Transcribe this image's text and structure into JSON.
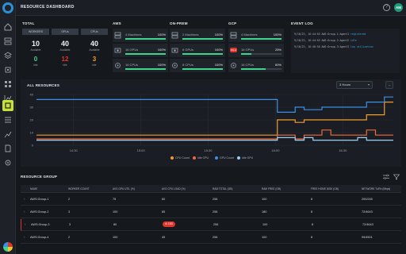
{
  "header": {
    "title": "RESOURCE DASHBOARD",
    "avatar_initials": "AM",
    "help_glyph": "?"
  },
  "sidebar": {
    "items": [
      {
        "icon": "home-icon"
      },
      {
        "icon": "server-icon"
      },
      {
        "icon": "layers-icon"
      },
      {
        "icon": "chip-icon"
      },
      {
        "icon": "grid-icon"
      },
      {
        "icon": "chart-icon"
      },
      {
        "icon": "group-icon",
        "active": true
      },
      {
        "icon": "list-icon"
      },
      {
        "icon": "chart-up-icon"
      },
      {
        "icon": "document-icon"
      },
      {
        "icon": "settings-icon"
      }
    ]
  },
  "total": {
    "label": "TOTAL",
    "columns": [
      {
        "header": "WORKERS",
        "big": "10",
        "sub": "Available",
        "value": "0",
        "value_color": "#3dd68c",
        "value_sub": "Idle"
      },
      {
        "header": "GPUs",
        "big": "40",
        "sub": "Available",
        "value": "12",
        "value_color": "#e0352b",
        "value_sub": "Idle"
      },
      {
        "header": "CPUs",
        "big": "40",
        "sub": "Available",
        "value": "3",
        "value_color": "#f39a2e",
        "value_sub": "Idle"
      }
    ]
  },
  "clouds": [
    {
      "label": "AWS",
      "rows": [
        {
          "icon": "server-icon",
          "text": "4 Machines",
          "pct": "100%",
          "fill": 1.0
        },
        {
          "icon": "gpu-icon",
          "text": "16 GPUs",
          "pct": "100%",
          "fill": 1.0
        },
        {
          "icon": "cpu-icon",
          "text": "16 CPUs",
          "pct": "100%",
          "fill": 1.0
        }
      ]
    },
    {
      "label": "ON-PREM",
      "rows": [
        {
          "icon": "server-icon",
          "text": "2 Machines",
          "pct": "100%",
          "fill": 1.0
        },
        {
          "icon": "gpu-icon",
          "text": "8 GPUs",
          "pct": "100%",
          "fill": 1.0
        },
        {
          "icon": "cpu-icon",
          "text": "8 CPUs",
          "pct": "100%",
          "fill": 1.0
        }
      ]
    },
    {
      "label": "GCP",
      "rows": [
        {
          "icon": "server-icon",
          "text": "4 Machines",
          "pct": "100%",
          "fill": 1.0,
          "badge": false
        },
        {
          "icon": "gpu-icon",
          "text": "16 GPUs",
          "pct": "25%",
          "fill": 0.25,
          "badge": true,
          "badge_text": "IDLE"
        },
        {
          "icon": "cpu-icon",
          "text": "16 CPUs",
          "pct": "60%",
          "fill": 0.6
        }
      ]
    }
  ],
  "event_log": {
    "label": "EVENT LOG",
    "events": [
      {
        "prefix": "9/18/23, 16:44:03  AWS:Group-1:Agent1  ",
        "highlight": "registered"
      },
      {
        "prefix": "9/18/23, 16:44:03  AWS:Group-2:Agent2  ",
        "highlight": "idle"
      },
      {
        "prefix": "9/18/23, 16:46:50  AWS:Group-3:Agent3  ",
        "highlight": "low utilization"
      }
    ]
  },
  "chart_header": {
    "label": "ALL RESOURCES",
    "range": "3 Hours",
    "expand_glyph": "⌄"
  },
  "chart_data": {
    "type": "line",
    "ylim": [
      0,
      40
    ],
    "yticks": [
      "0",
      "10",
      "20",
      "30",
      "40"
    ],
    "xticks": [
      "14:30",
      "15:00",
      "15:30",
      "16:00",
      "16:30"
    ],
    "x": [
      0,
      1,
      2,
      3,
      4,
      5,
      6,
      7,
      8,
      9,
      10,
      11,
      12,
      13,
      14,
      15,
      16,
      17,
      18,
      19,
      20,
      21,
      22,
      23,
      24,
      25,
      26,
      27,
      28,
      29,
      30,
      31,
      32,
      33,
      34,
      35,
      36,
      37,
      38,
      39,
      40
    ],
    "series": [
      {
        "name": "CPU Count",
        "color": "#f39a2e",
        "values": [
          8,
          8,
          8,
          8,
          8,
          8,
          8,
          8,
          8,
          8,
          8,
          8,
          8,
          8,
          8,
          8,
          8,
          8,
          8,
          8,
          8,
          8,
          8,
          8,
          8,
          8,
          8,
          20,
          20,
          18,
          20,
          20,
          20,
          20,
          20,
          20,
          20,
          24,
          24,
          34,
          34
        ]
      },
      {
        "name": "Idle CPU",
        "color": "#ef6a3a",
        "values": [
          5,
          5,
          5,
          5,
          5,
          5,
          5,
          5,
          5,
          5,
          5,
          5,
          5,
          5,
          5,
          5,
          5,
          5,
          5,
          5,
          5,
          5,
          5,
          5,
          5,
          5,
          5,
          8,
          8,
          5,
          8,
          8,
          12,
          8,
          8,
          8,
          8,
          12,
          8,
          8,
          8
        ]
      },
      {
        "name": "GPU Count",
        "color": "#3a8fe6",
        "values": [
          36,
          36,
          36,
          36,
          36,
          36,
          36,
          36,
          36,
          36,
          36,
          36,
          36,
          36,
          36,
          36,
          36,
          36,
          36,
          36,
          36,
          36,
          36,
          36,
          36,
          36,
          36,
          26,
          26,
          30,
          28,
          28,
          30,
          30,
          30,
          30,
          30,
          34,
          34,
          38,
          38
        ]
      },
      {
        "name": "Idle GPU",
        "color": "#9ad0f5",
        "values": [
          4,
          4,
          4,
          4,
          4,
          4,
          4,
          4,
          4,
          4,
          4,
          4,
          4,
          4,
          4,
          4,
          4,
          4,
          4,
          4,
          4,
          4,
          4,
          4,
          4,
          4,
          4,
          6,
          6,
          4,
          6,
          4,
          4,
          4,
          4,
          4,
          6,
          4,
          4,
          4,
          4
        ]
      }
    ],
    "grid": true,
    "legend": "bottom-center"
  },
  "table": {
    "label": "RESOURCE GROUP",
    "columns": [
      "NAME",
      "WORKER COUNT",
      "AVG GPU UTIL (%)",
      "AVG CPU LOAD (%)",
      "RAM TOTAL (GB)",
      "RAM FREE (GB)",
      "FREE HOME DISK (GB)",
      "NETWORK Tx/Rx (Mbps)"
    ],
    "rows": [
      {
        "name": "AWS:Group-1",
        "workers": "2",
        "gpu": "75",
        "cpu": "60",
        "cpu_alert": false,
        "ram_total": "256",
        "ram_free": "100",
        "disk": "8",
        "net": "200/245"
      },
      {
        "name": "AWS:Group-2",
        "workers": "3",
        "gpu": "100",
        "cpu": "85",
        "cpu_alert": false,
        "ram_total": "256",
        "ram_free": "180",
        "disk": "8",
        "net": "72/4643"
      },
      {
        "name": "AWS:Group-3",
        "workers": "3",
        "gpu": "80",
        "cpu": "100",
        "cpu_alert": true,
        "ram_total": "256",
        "ram_free": "100",
        "disk": "8",
        "net": "72/4643"
      },
      {
        "name": "AWS:Group-4",
        "workers": "2",
        "gpu": "100",
        "cpu": "45",
        "cpu_alert": false,
        "ram_total": "256",
        "ram_free": "100",
        "disk": "8",
        "net": "99/4501"
      }
    ]
  }
}
